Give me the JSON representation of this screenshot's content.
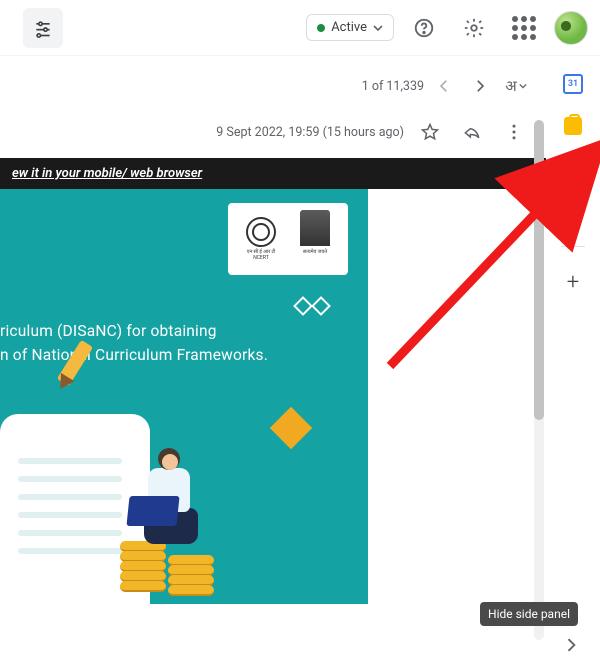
{
  "topbar": {
    "status_label": "Active"
  },
  "pager": {
    "position_text": "1 of 11,339",
    "lang_label": "अ"
  },
  "message": {
    "timestamp": "9 Sept 2022, 19:59 (15 hours ago)"
  },
  "banner": {
    "text": "ew it in your mobile/ web browser"
  },
  "email_body": {
    "logo1_caption": "NCERT",
    "logo2_caption": "—",
    "line1": "riculum (DISaNC) for obtaining",
    "line2": "n of National Curriculum Frameworks."
  },
  "sidepanel": {
    "tooltip": "Hide side panel",
    "calendar_day": "31",
    "plus": "+"
  }
}
